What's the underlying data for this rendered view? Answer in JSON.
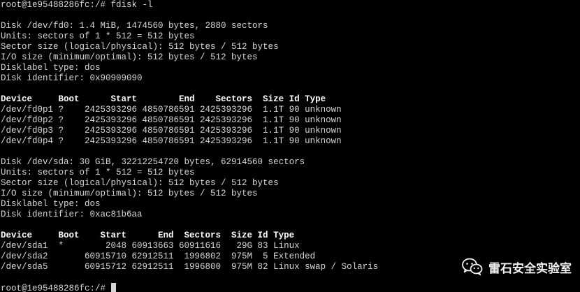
{
  "terminal": {
    "lines": [
      {
        "text": "root@1e95488286fc:/# fdisk -l",
        "style": "prompt"
      },
      {
        "text": "",
        "style": "blank"
      },
      {
        "text": "Disk /dev/fd0: 1.4 MiB, 1474560 bytes, 2880 sectors",
        "style": "normal"
      },
      {
        "text": "Units: sectors of 1 * 512 = 512 bytes",
        "style": "normal"
      },
      {
        "text": "Sector size (logical/physical): 512 bytes / 512 bytes",
        "style": "normal"
      },
      {
        "text": "I/O size (minimum/optimal): 512 bytes / 512 bytes",
        "style": "normal"
      },
      {
        "text": "Disklabel type: dos",
        "style": "normal"
      },
      {
        "text": "Disk identifier: 0x90909090",
        "style": "normal"
      },
      {
        "text": "",
        "style": "blank"
      },
      {
        "text": "Device     Boot      Start        End    Sectors  Size Id Type",
        "style": "bold"
      },
      {
        "text": "/dev/fd0p1 ?    2425393296 4850786591 2425393296  1.1T 90 unknown",
        "style": "normal"
      },
      {
        "text": "/dev/fd0p2 ?    2425393296 4850786591 2425393296  1.1T 90 unknown",
        "style": "normal"
      },
      {
        "text": "/dev/fd0p3 ?    2425393296 4850786591 2425393296  1.1T 90 unknown",
        "style": "normal"
      },
      {
        "text": "/dev/fd0p4 ?    2425393296 4850786591 2425393296  1.1T 90 unknown",
        "style": "normal"
      },
      {
        "text": "",
        "style": "blank"
      },
      {
        "text": "Disk /dev/sda: 30 GiB, 32212254720 bytes, 62914560 sectors",
        "style": "normal"
      },
      {
        "text": "Units: sectors of 1 * 512 = 512 bytes",
        "style": "normal"
      },
      {
        "text": "Sector size (logical/physical): 512 bytes / 512 bytes",
        "style": "normal"
      },
      {
        "text": "I/O size (minimum/optimal): 512 bytes / 512 bytes",
        "style": "normal"
      },
      {
        "text": "Disklabel type: dos",
        "style": "normal"
      },
      {
        "text": "Disk identifier: 0xac81b6aa",
        "style": "normal"
      },
      {
        "text": "",
        "style": "blank"
      },
      {
        "text": "Device     Boot    Start      End  Sectors  Size Id Type",
        "style": "bold"
      },
      {
        "text": "/dev/sda1  *        2048 60913663 60911616   29G 83 Linux",
        "style": "normal"
      },
      {
        "text": "/dev/sda2       60915710 62912511  1996802  975M  5 Extended",
        "style": "normal"
      },
      {
        "text": "/dev/sda5       60915712 62912511  1996800  975M 82 Linux swap / Solaris",
        "style": "normal"
      },
      {
        "text": "",
        "style": "blank"
      },
      {
        "text": "root@1e95488286fc:/# ",
        "style": "prompt-cursor"
      }
    ]
  },
  "watermark": {
    "icon": "wechat-icon",
    "label": "雷石安全实验室"
  },
  "colors": {
    "background": "#000000",
    "text": "#d6d6d6",
    "bold_text": "#ffffff"
  }
}
